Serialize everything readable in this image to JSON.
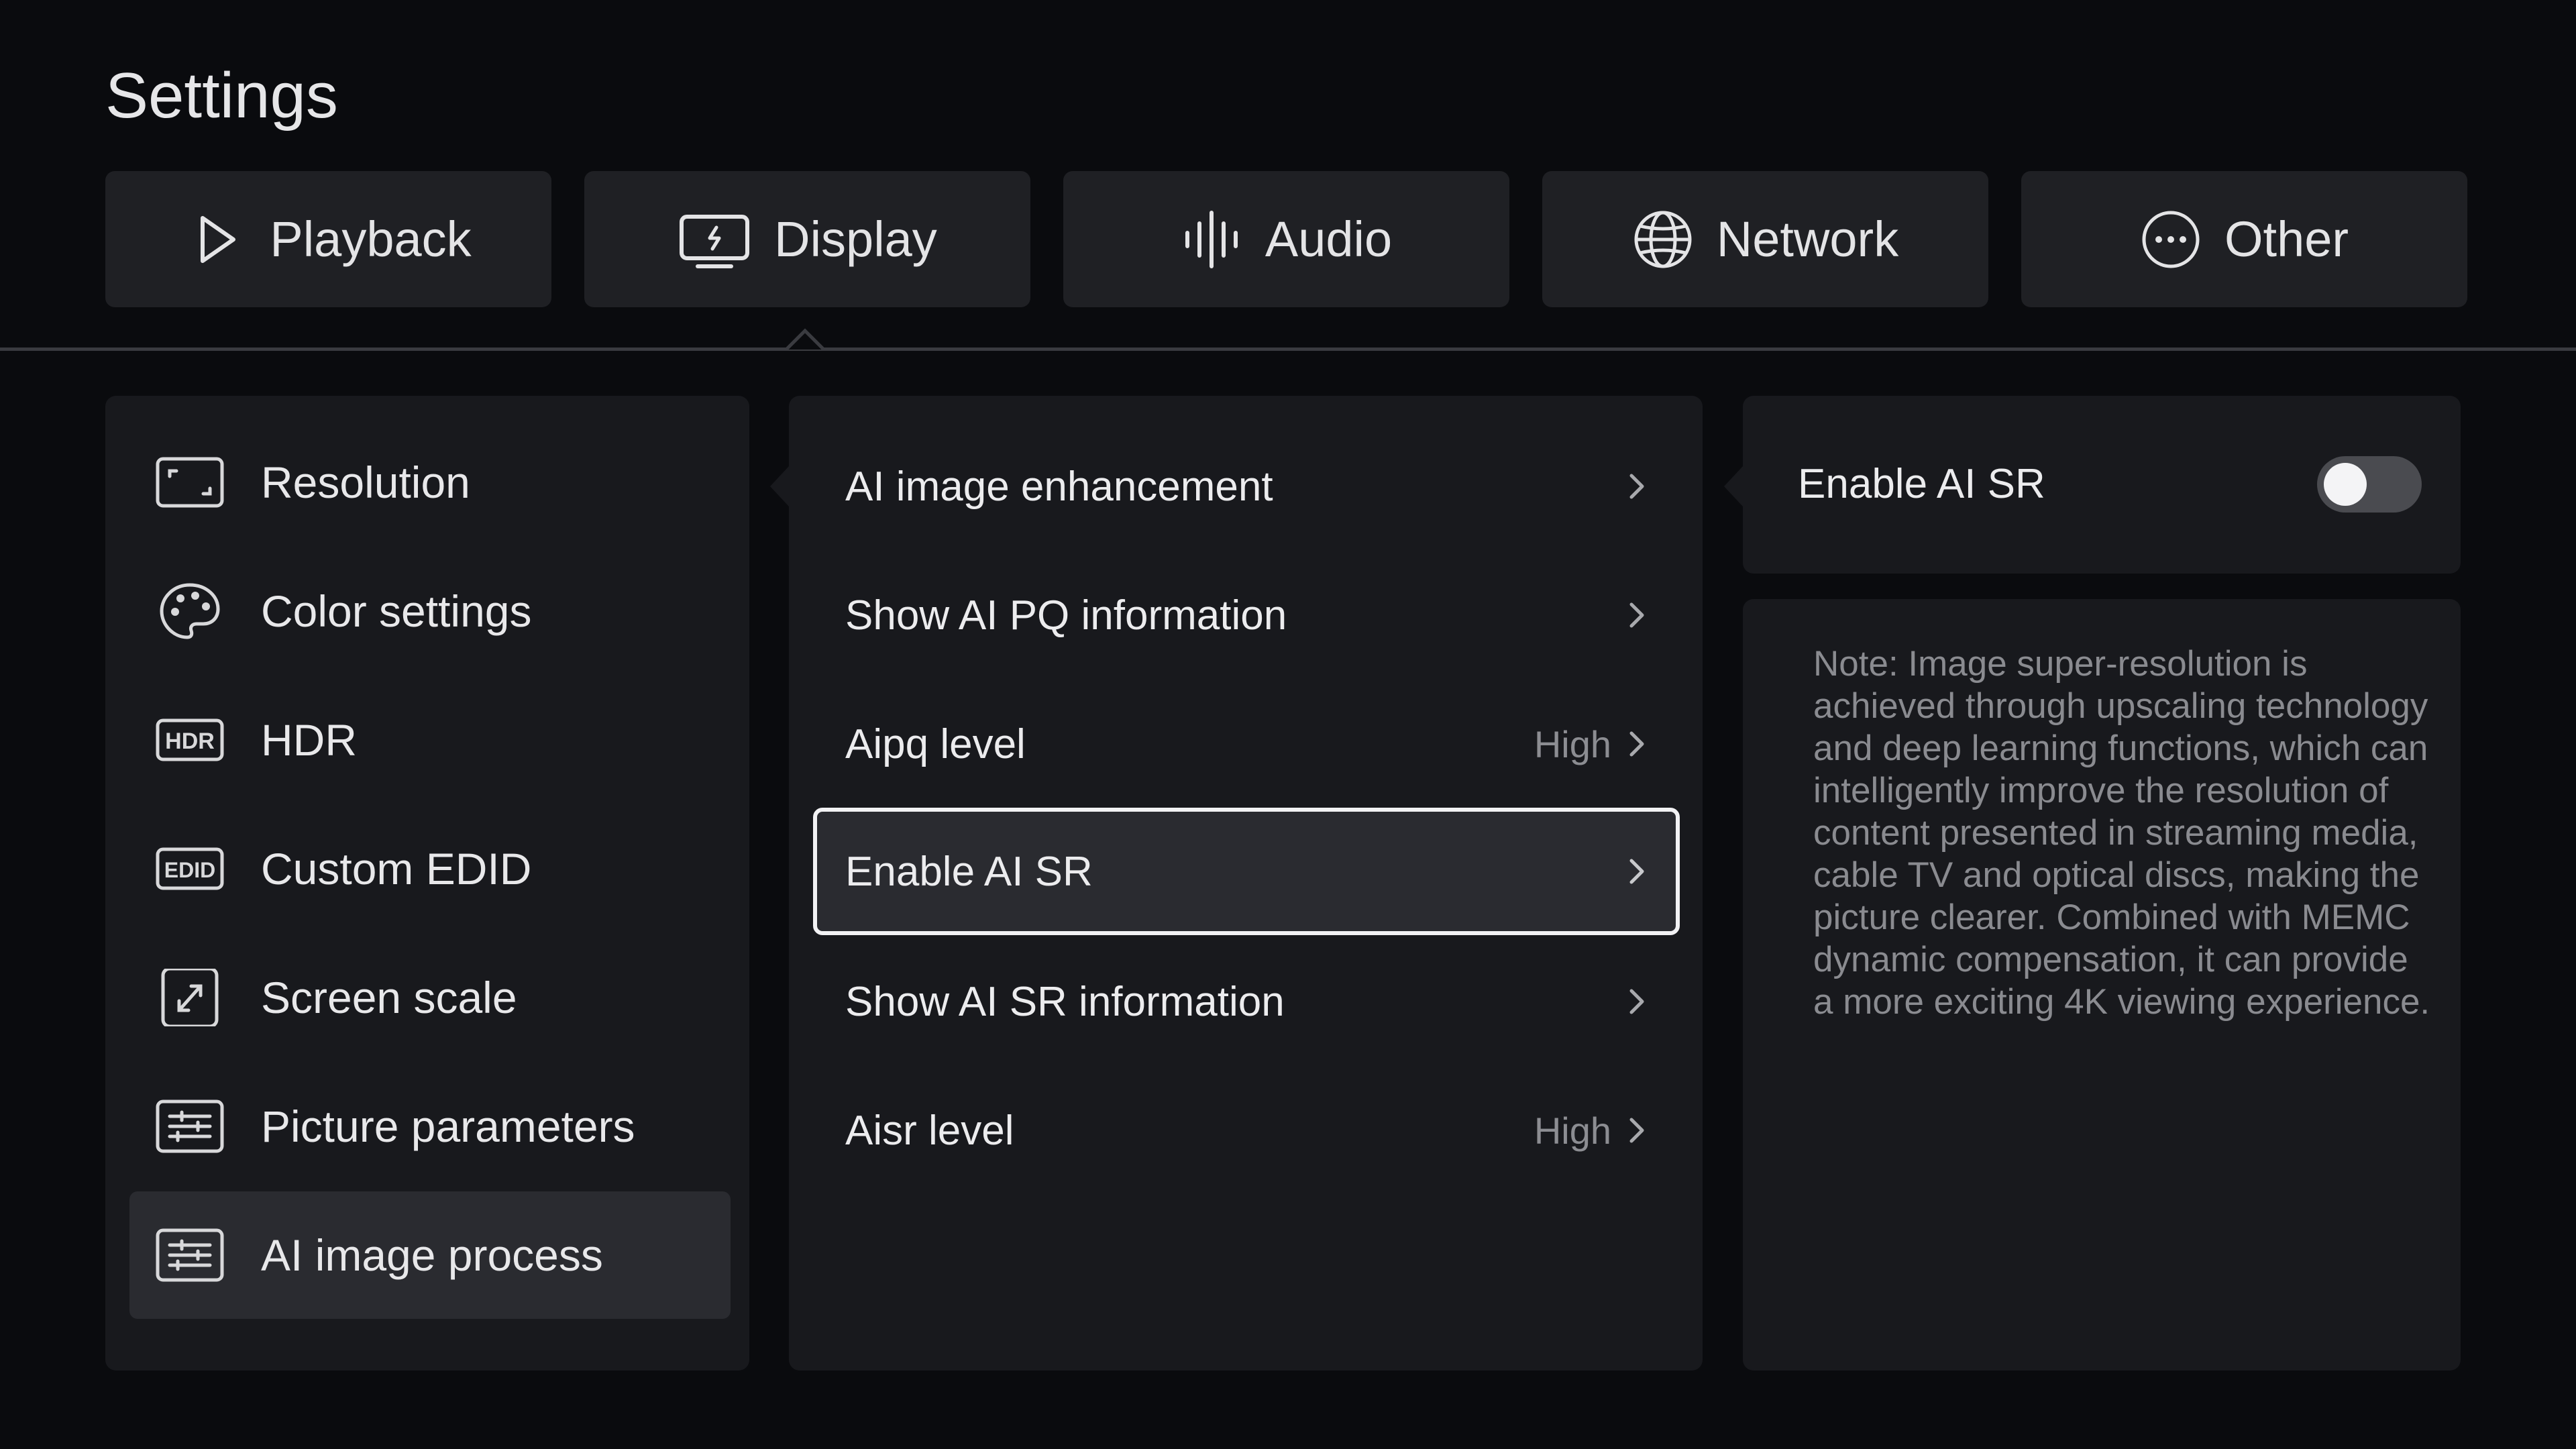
{
  "page": {
    "title": "Settings"
  },
  "tabs": [
    {
      "label": "Playback",
      "icon": "play-icon"
    },
    {
      "label": "Display",
      "icon": "display-icon"
    },
    {
      "label": "Audio",
      "icon": "audio-wave-icon"
    },
    {
      "label": "Network",
      "icon": "globe-icon"
    },
    {
      "label": "Other",
      "icon": "more-icon"
    }
  ],
  "active_tab": "Display",
  "categories": [
    {
      "label": "Resolution",
      "icon": "resolution-icon"
    },
    {
      "label": "Color settings",
      "icon": "palette-icon"
    },
    {
      "label": "HDR",
      "icon": "hdr-icon"
    },
    {
      "label": "Custom EDID",
      "icon": "edid-icon"
    },
    {
      "label": "Screen scale",
      "icon": "screen-scale-icon"
    },
    {
      "label": "Picture parameters",
      "icon": "sliders-icon"
    },
    {
      "label": "AI image process",
      "icon": "sliders-icon"
    }
  ],
  "selected_category": "AI image process",
  "options": [
    {
      "label": "AI image enhancement",
      "value": ""
    },
    {
      "label": "Show AI PQ information",
      "value": ""
    },
    {
      "label": "Aipq level",
      "value": "High"
    },
    {
      "label": "Enable AI SR",
      "value": ""
    },
    {
      "label": "Show AI SR information",
      "value": ""
    },
    {
      "label": "Aisr level",
      "value": "High"
    }
  ],
  "focused_option": "Enable AI SR",
  "detail": {
    "toggle_label": "Enable AI SR",
    "toggle_on": false,
    "note": "Note: Image super-resolution is achieved through upscaling technology and deep learning functions, which can intelligently improve the resolution of content presented in streaming media, cable TV and optical discs, making the picture clearer. Combined with MEMC dynamic compensation, it can provide a more exciting 4K viewing experience."
  },
  "colors": {
    "background": "#0a0b0e",
    "panel": "#18191d",
    "tab": "#1f2024",
    "selected": "#2a2b30",
    "focus_border": "#f2f2f4",
    "muted_text": "#8a8b90"
  }
}
